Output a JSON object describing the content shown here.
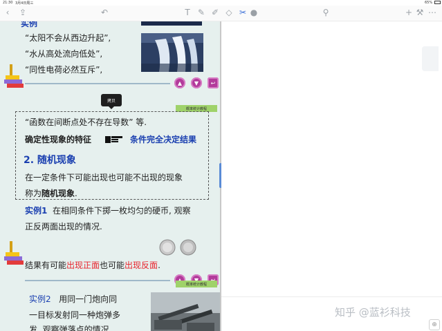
{
  "status": {
    "time": "21:30",
    "date": "3月4日周三",
    "battery": "65%"
  },
  "toolbar": {
    "back_icon": "chevron-left-icon",
    "share_icon": "share-icon",
    "undo_icon": "undo-icon",
    "tools": [
      "text-icon",
      "pen-icon",
      "highlighter-icon",
      "eraser-icon",
      "scissors-icon",
      "apple-icon"
    ],
    "mic_icon": "microphone-icon",
    "add_icon": "plus-icon",
    "settings_icon": "wrench-icon",
    "more_icon": "more-icon"
  },
  "tooltip": "拷贝",
  "slide1": {
    "heading": "实例",
    "lines": [
      "“太阳不会从西边升起”,",
      "“水从高处流向低处”,",
      "“同性电荷必然互斥”,"
    ]
  },
  "slide2": {
    "tag": "概率统计教程",
    "line1": "“函数在间断点处不存在导数” 等.",
    "feature_label": "确定性现象的特征",
    "feature_value": "条件完全决定结果",
    "section_title": "2. 随机现象",
    "def1": "在一定条件下可能出现也可能不出现的现象",
    "def2_a": "称为",
    "def2_b": "随机现象",
    "def2_c": ".",
    "example_label": "实例1",
    "example_text1": "在相同条件下掷一枚均匀的硬币, 观察",
    "example_text2": "正反两面出现的情况.",
    "result_a": "结果有可能",
    "result_b": "出现正面",
    "result_c": "也可能",
    "result_d": "出现反面",
    "result_e": "."
  },
  "slide3": {
    "tag": "概率统计教程",
    "example_label": "实例2",
    "line1": "用同一门炮向同",
    "line2": "一目标发射同一种炮弹多",
    "line3": "发, 观察弹落点的情况."
  },
  "watermark": "知乎 @蓝衫科技",
  "colors": {
    "accent_blue": "#1a3fb0",
    "accent_red": "#e8222b",
    "nav_button": "#b23b9b",
    "slide_bg": "#e6f0ee"
  }
}
